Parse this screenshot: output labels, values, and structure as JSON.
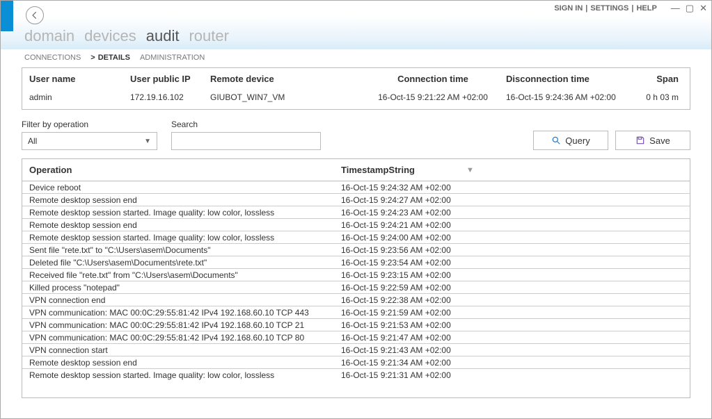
{
  "topbar": {
    "signin": "SIGN IN",
    "settings": "SETTINGS",
    "help": "HELP"
  },
  "main_nav": {
    "items": [
      {
        "label": "domain",
        "active": false
      },
      {
        "label": "devices",
        "active": false
      },
      {
        "label": "audit",
        "active": true
      },
      {
        "label": "router",
        "active": false
      }
    ]
  },
  "sub_nav": {
    "items": [
      {
        "label": "CONNECTIONS",
        "active": false
      },
      {
        "label": "DETAILS",
        "active": true
      },
      {
        "label": "ADMINISTRATION",
        "active": false
      }
    ]
  },
  "summary": {
    "headers": {
      "user": "User name",
      "ip": "User public IP",
      "device": "Remote device",
      "conn": "Connection time",
      "disc": "Disconnection time",
      "span": "Span"
    },
    "row": {
      "user": "admin",
      "ip": "172.19.16.102",
      "device": "GIUBOT_WIN7_VM",
      "conn": "16-Oct-15 9:21:22 AM +02:00",
      "disc": "16-Oct-15 9:24:36 AM +02:00",
      "span": "0 h 03 m"
    }
  },
  "filters": {
    "operation_label": "Filter by operation",
    "operation_value": "All",
    "search_label": "Search",
    "search_value": "",
    "query_btn": "Query",
    "save_btn": "Save"
  },
  "grid": {
    "headers": {
      "op": "Operation",
      "ts": "TimestampString"
    },
    "rows": [
      {
        "op": "Device reboot",
        "ts": "16-Oct-15 9:24:32 AM +02:00"
      },
      {
        "op": "Remote desktop session end",
        "ts": "16-Oct-15 9:24:27 AM +02:00"
      },
      {
        "op": "Remote desktop session started. Image quality: low color, lossless",
        "ts": "16-Oct-15 9:24:23 AM +02:00"
      },
      {
        "op": "Remote desktop session end",
        "ts": "16-Oct-15 9:24:21 AM +02:00"
      },
      {
        "op": "Remote desktop session started. Image quality: low color, lossless",
        "ts": "16-Oct-15 9:24:00 AM +02:00"
      },
      {
        "op": "Sent file \"rete.txt\" to \"C:\\Users\\asem\\Documents\"",
        "ts": "16-Oct-15 9:23:56 AM +02:00"
      },
      {
        "op": "Deleted file \"C:\\Users\\asem\\Documents\\rete.txt\"",
        "ts": "16-Oct-15 9:23:54 AM +02:00"
      },
      {
        "op": "Received file \"rete.txt\" from \"C:\\Users\\asem\\Documents\"",
        "ts": "16-Oct-15 9:23:15 AM +02:00"
      },
      {
        "op": "Killed process \"notepad\"",
        "ts": "16-Oct-15 9:22:59 AM +02:00"
      },
      {
        "op": "VPN connection end",
        "ts": "16-Oct-15 9:22:38 AM +02:00"
      },
      {
        "op": "VPN communication: MAC 00:0C:29:55:81:42 IPv4 192.168.60.10 TCP 443",
        "ts": "16-Oct-15 9:21:59 AM +02:00"
      },
      {
        "op": "VPN communication: MAC 00:0C:29:55:81:42 IPv4 192.168.60.10 TCP 21",
        "ts": "16-Oct-15 9:21:53 AM +02:00"
      },
      {
        "op": "VPN communication: MAC 00:0C:29:55:81:42 IPv4 192.168.60.10 TCP 80",
        "ts": "16-Oct-15 9:21:47 AM +02:00"
      },
      {
        "op": "VPN connection start",
        "ts": "16-Oct-15 9:21:43 AM +02:00"
      },
      {
        "op": "Remote desktop session end",
        "ts": "16-Oct-15 9:21:34 AM +02:00"
      },
      {
        "op": "Remote desktop session started. Image quality: low color, lossless",
        "ts": "16-Oct-15 9:21:31 AM +02:00"
      }
    ]
  }
}
